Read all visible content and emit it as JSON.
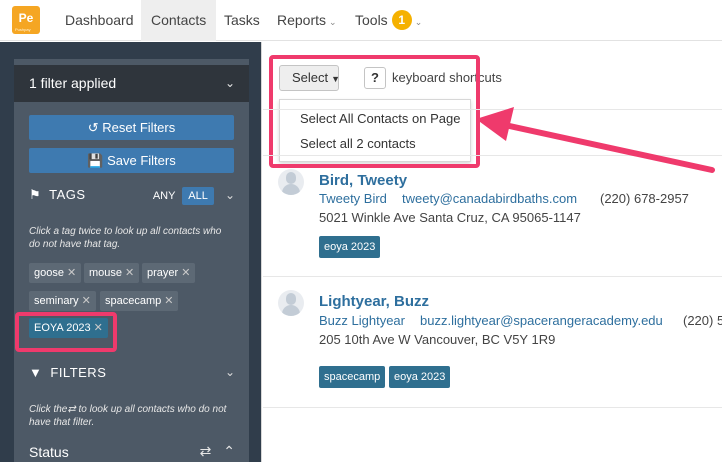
{
  "app": {
    "logo_text": "Pe",
    "logo_sub": "Pushpay"
  },
  "nav": {
    "items": [
      {
        "label": "Dashboard"
      },
      {
        "label": "Contacts"
      },
      {
        "label": "Tasks"
      },
      {
        "label": "Reports"
      },
      {
        "label": "Tools",
        "badge": "1"
      }
    ]
  },
  "sidebar": {
    "filter_summary": "1 filter applied",
    "reset_label": "Reset Filters",
    "save_label": "Save Filters",
    "tags_title": "TAGS",
    "any_label": "ANY",
    "all_label": "ALL",
    "tags_help": "Click a tag twice to look up all contacts who do not have that tag.",
    "tags": [
      "goose",
      "mouse",
      "prayer",
      "seminary",
      "spacecamp",
      "EOYA 2023"
    ],
    "filters_title": "FILTERS",
    "filters_help_pre": "Click the",
    "filters_help_post": "to look up all contacts who do not have that filter.",
    "status_label": "Status"
  },
  "toolbar": {
    "select_label": "Select",
    "help_label": "?",
    "shortcuts_label": "keyboard shortcuts"
  },
  "select_menu": {
    "items": [
      "Select All Contacts on Page",
      "Select all 2 contacts"
    ]
  },
  "contacts": [
    {
      "name": "Bird, Tweety",
      "display_name": "Tweety Bird",
      "email": "tweety@canadabirdbaths.com",
      "phone": "(220) 678-2957",
      "address": "5021 Winkle Ave Santa Cruz, CA 95065-1147",
      "tags": [
        "eoya 2023"
      ]
    },
    {
      "name": "Lightyear, Buzz",
      "display_name": "Buzz Lightyear",
      "email": "buzz.lightyear@spacerangeracademy.edu",
      "phone": "(220) 5",
      "address": "205 10th Ave W Vancouver, BC V5Y 1R9",
      "tags": [
        "spacecamp",
        "eoya 2023"
      ]
    }
  ],
  "colors": {
    "accent": "#3e7ab0",
    "highlight": "#ef3a6c",
    "badge": "#f5b100",
    "logo": "#f5a623"
  }
}
